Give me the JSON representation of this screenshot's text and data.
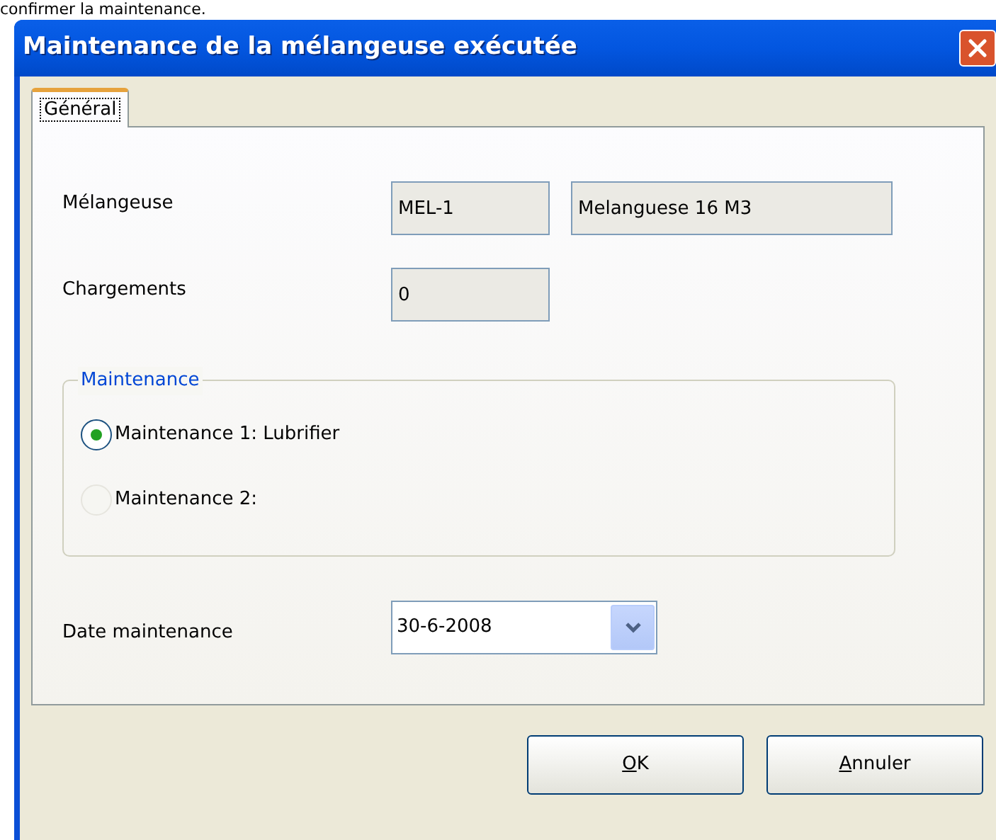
{
  "caption": "confirmer la maintenance.",
  "window": {
    "title": "Maintenance de la mélangeuse exécutée"
  },
  "tabs": [
    {
      "label": "Général",
      "selected": true
    }
  ],
  "fields": [
    {
      "label": "Mélangeuse",
      "values": [
        "MEL-1",
        "Melanguese 16 M3"
      ]
    },
    {
      "label": "Chargements",
      "values": [
        "0"
      ]
    }
  ],
  "group": {
    "title": "Maintenance",
    "options": [
      {
        "label": "Maintenance 1: Lubrifier",
        "selected": true
      },
      {
        "label": "Maintenance 2:",
        "selected": false
      }
    ]
  },
  "date": {
    "label": "Date maintenance",
    "value": "30-6-2008"
  },
  "buttons": [
    "OK",
    "Annuler"
  ]
}
